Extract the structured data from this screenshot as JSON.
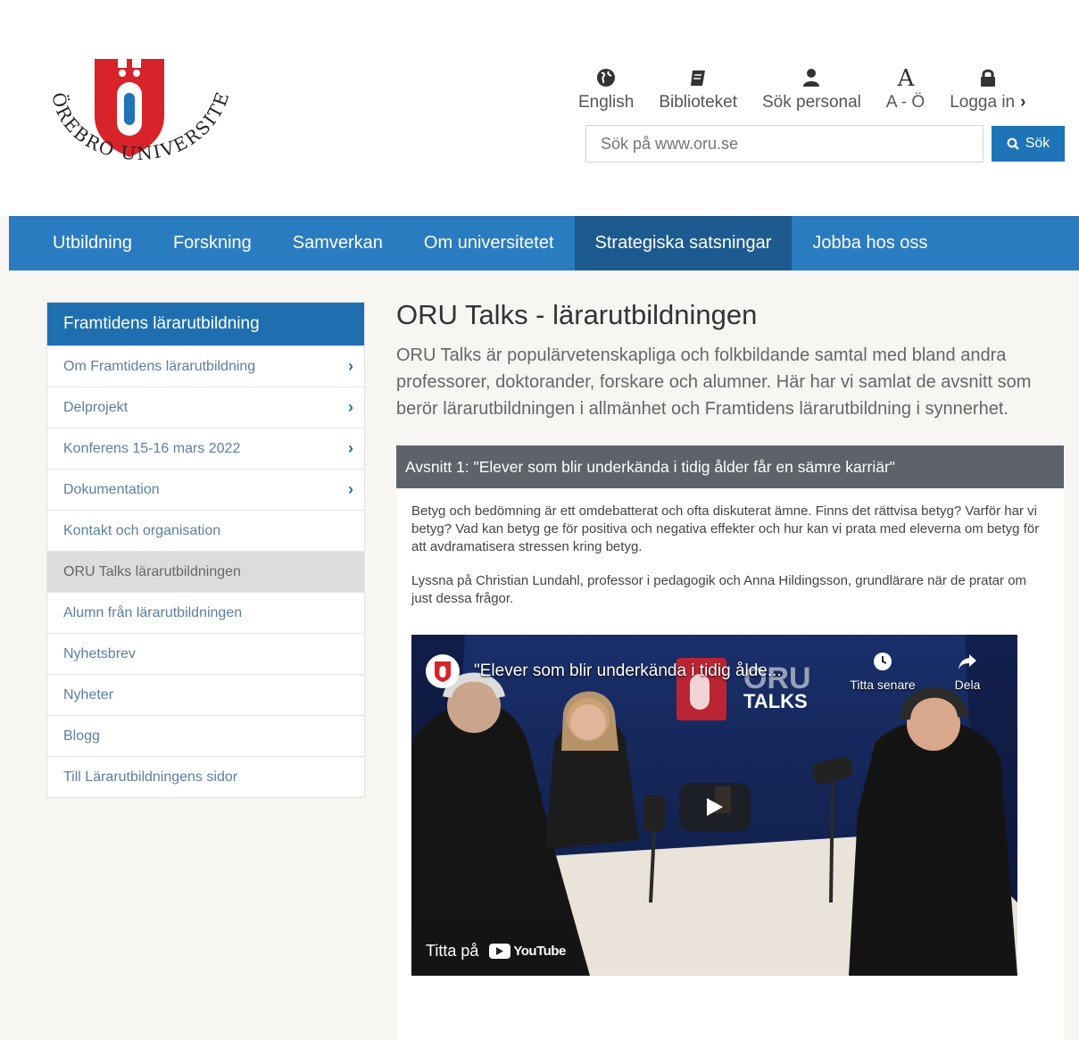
{
  "header": {
    "logo": {
      "text": "ÖREBRO UNIVERSITET",
      "letter": "Ö",
      "color": "#d8232a"
    },
    "util_nav": [
      {
        "label": "English",
        "icon": "globe-icon"
      },
      {
        "label": "Biblioteket",
        "icon": "book-icon"
      },
      {
        "label": "Sök personal",
        "icon": "person-icon"
      },
      {
        "label": "A - Ö",
        "icon": "letter-a-icon"
      },
      {
        "label": "Logga in",
        "icon": "lock-icon"
      }
    ],
    "search": {
      "placeholder": "Sök på www.oru.se",
      "button_label": "Sök"
    }
  },
  "main_nav": {
    "items": [
      "Utbildning",
      "Forskning",
      "Samverkan",
      "Om universitetet",
      "Strategiska satsningar",
      "Jobba hos oss"
    ],
    "active": "Strategiska satsningar"
  },
  "sidebar": {
    "header": "Framtidens lärarutbildning",
    "items": [
      {
        "label": "Om Framtidens lärarutbildning",
        "has_children": true
      },
      {
        "label": "Delprojekt",
        "has_children": true
      },
      {
        "label": "Konferens 15-16 mars 2022",
        "has_children": true
      },
      {
        "label": "Dokumentation",
        "has_children": true
      },
      {
        "label": "Kontakt och organisation",
        "has_children": false
      },
      {
        "label": "ORU Talks lärarutbildningen",
        "has_children": false,
        "active": true
      },
      {
        "label": "Alumn från lärarutbildningen",
        "has_children": false
      },
      {
        "label": "Nyhetsbrev",
        "has_children": false
      },
      {
        "label": "Nyheter",
        "has_children": false
      },
      {
        "label": "Blogg",
        "has_children": false
      },
      {
        "label": "Till Lärarutbildningens sidor",
        "has_children": false
      }
    ]
  },
  "content": {
    "title": "ORU Talks - lärarutbildningen",
    "intro": "ORU Talks är populärvetenskapliga och folkbildande samtal med bland andra professorer, doktorander, forskare och alumner. Här har vi samlat de avsnitt som berör lärarutbildningen i allmänhet och Framtidens lärarutbildning i synnerhet.",
    "episode": {
      "heading": "Avsnitt 1: \"Elever som blir underkända i tidig ålder får en sämre karriär\"",
      "paragraph1": "Betyg och bedömning är ett omdebatterat och ofta diskuterat ämne. Finns det rättvisa betyg? Varför har vi betyg? Vad kan betyg ge för positiva och negativa effekter och hur kan vi prata med eleverna om betyg för att avdramatisera stressen kring betyg.",
      "paragraph2": "Lyssna på Christian Lundahl, professor i pedagogik och Anna Hildingsson, grundlärare när de pratar om just dessa frågor.",
      "video": {
        "title": "\"Elever som blir underkända i tidig ålde...",
        "watch_later": "Titta senare",
        "share": "Dela",
        "watch_on": "Titta på",
        "youtube": "YouTube",
        "brand_top": "ORU",
        "brand_bottom": "TALKS"
      }
    }
  },
  "colors": {
    "primary": "#2a7cc1",
    "nav_active": "#1c5a8f",
    "sidebar_header": "#1f6fb0",
    "episode_bar": "#5e6369"
  }
}
